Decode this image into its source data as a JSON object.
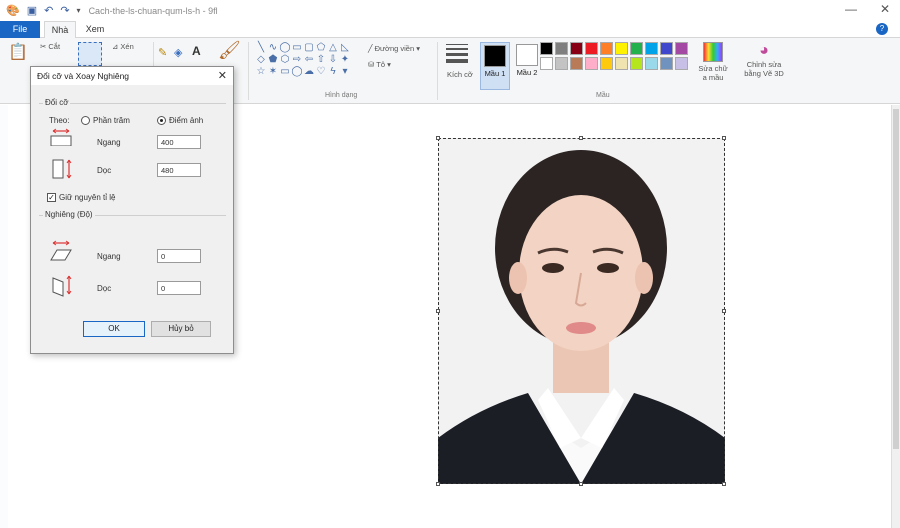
{
  "window": {
    "title": "Cach-the-ls-chuan-qum-ls-h - 9fl",
    "min": "—",
    "close": "✕"
  },
  "tabs": {
    "file": "File",
    "home": "Nhà",
    "view": "Xem"
  },
  "ribbon": {
    "clipboard": {
      "paste": "Dán",
      "cut": "Cắt"
    },
    "image": {
      "crop": "Xén"
    },
    "shapes_label": "Hình dạng",
    "outline": "Đường viền",
    "fill": "Tô",
    "size": "Kích cỡ",
    "color1": "Mầu 1",
    "color2": "Mầu 2",
    "colors_label": "Mầu",
    "edit_colors": "Sửa chữ a mầu",
    "paint3d": "Chỉnh sửa bằng Vẽ 3D",
    "palette": [
      "#000000",
      "#7f7f7f",
      "#880015",
      "#ed1c24",
      "#ff7f27",
      "#fff200",
      "#22b14c",
      "#00a2e8",
      "#3f48cc",
      "#a349a4",
      "#ffffff",
      "#c3c3c3",
      "#b97a57",
      "#ffaec9",
      "#ffc90e",
      "#efe4b0",
      "#b5e61d",
      "#99d9ea",
      "#7092be",
      "#c8bfe7"
    ]
  },
  "dialog": {
    "title": "Đổi cỡ và Xoay Nghiêng",
    "resize_group": "Đổi cỡ",
    "by_label": "Theo:",
    "percent_label": "Phần trăm",
    "pixels_label": "Điểm ảnh",
    "horizontal_label": "Ngang",
    "vertical_label": "Dọc",
    "resize_h_value": "400",
    "resize_v_value": "480",
    "keep_ratio_label": "Giữ nguyên tỉ lệ",
    "skew_group": "Nghiêng (Độ)",
    "skew_h_value": "0",
    "skew_v_value": "0",
    "ok_label": "OK",
    "cancel_label": "Hủy bỏ"
  }
}
